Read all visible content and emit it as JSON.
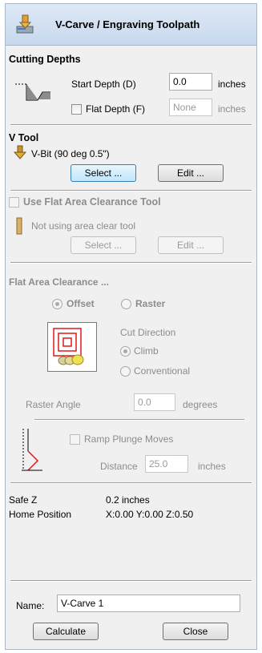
{
  "header": {
    "title": "V-Carve / Engraving Toolpath",
    "icon": "toolpath-icon"
  },
  "cutting_depths": {
    "section_label": "Cutting Depths",
    "start_depth_label": "Start Depth (D)",
    "start_depth_value": "0.0",
    "start_depth_unit": "inches",
    "flat_depth_label": "Flat Depth (F)",
    "flat_depth_checked": false,
    "flat_depth_value": "None",
    "flat_depth_unit": "inches"
  },
  "v_tool": {
    "section_label": "V Tool",
    "tool_name": "V-Bit (90 deg 0.5\")",
    "select_label": "Select ...",
    "edit_label": "Edit ..."
  },
  "flat_area_tool": {
    "checkbox_label": "Use Flat Area Clearance Tool",
    "checked": false,
    "status_text": "Not using area clear tool",
    "select_label": "Select ...",
    "edit_label": "Edit ..."
  },
  "flat_area_clearance": {
    "section_label": "Flat Area Clearance ...",
    "offset_label": "Offset",
    "raster_label": "Raster",
    "selected_strategy": "Offset",
    "cut_direction_label": "Cut Direction",
    "climb_label": "Climb",
    "conventional_label": "Conventional",
    "selected_direction": "Climb",
    "raster_angle_label": "Raster Angle",
    "raster_angle_value": "0.0",
    "raster_angle_unit": "degrees"
  },
  "ramp": {
    "checkbox_label": "Ramp Plunge Moves",
    "checked": false,
    "distance_label": "Distance",
    "distance_value": "25.0",
    "distance_unit": "inches"
  },
  "info": {
    "safe_z_label": "Safe Z",
    "safe_z_value": "0.2 inches",
    "home_label": "Home Position",
    "home_value": "X:0.00 Y:0.00 Z:0.50"
  },
  "name_field": {
    "label": "Name:",
    "value": "V-Carve 1"
  },
  "footer": {
    "calculate_label": "Calculate",
    "close_label": "Close"
  },
  "colors": {
    "header_bg": "#c8d9ee",
    "panel_bg": "#f0f0f0",
    "strategy_red": "#e01818",
    "primary_border": "#3c7fb1"
  }
}
